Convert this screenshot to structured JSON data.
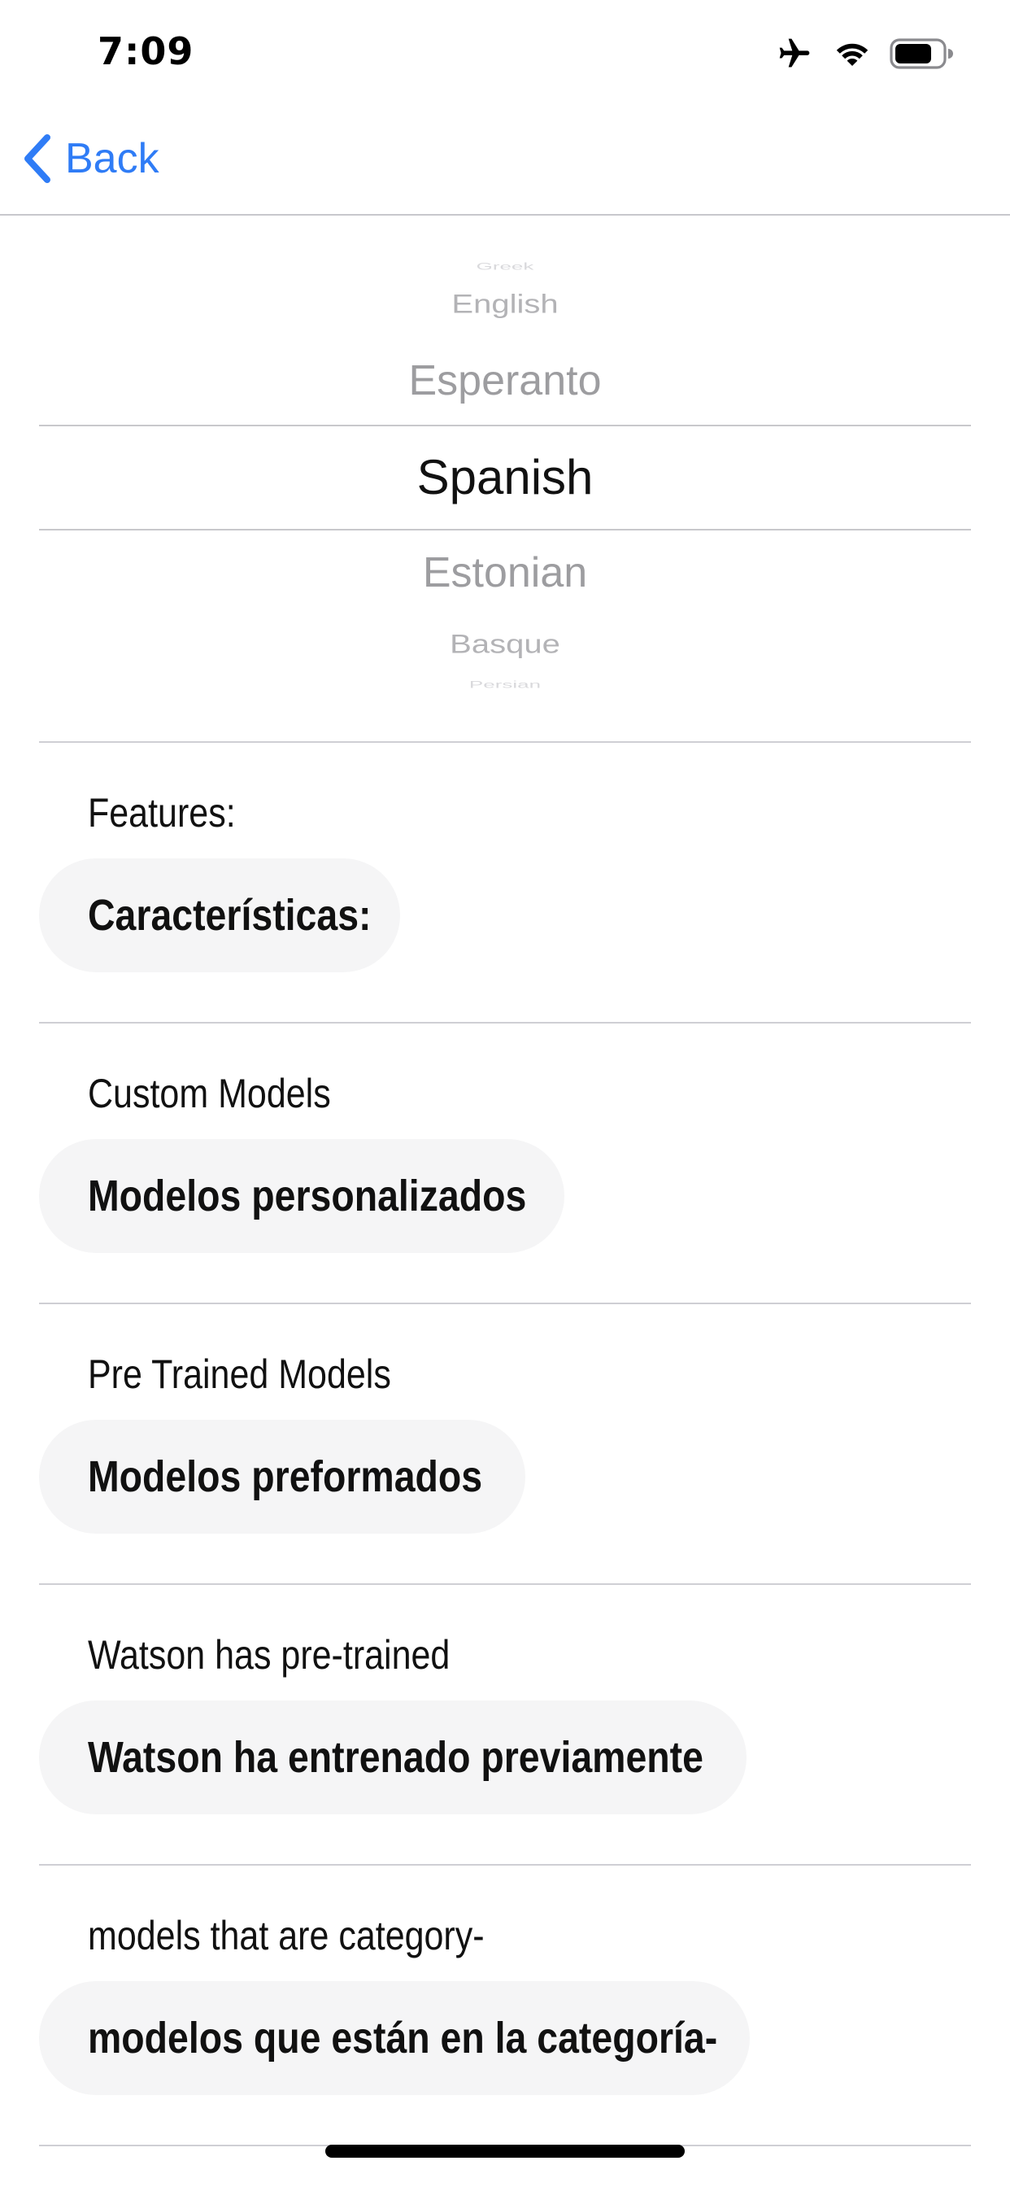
{
  "status_bar": {
    "time": "7:09"
  },
  "nav": {
    "back_label": "Back"
  },
  "picker": {
    "items": [
      "Greek",
      "English",
      "Esperanto",
      "Spanish",
      "Estonian",
      "Basque",
      "Persian"
    ],
    "selected": "Spanish"
  },
  "translations": [
    {
      "source": "Features:",
      "translated": "Características:"
    },
    {
      "source": "Custom Models",
      "translated": "Modelos personalizados"
    },
    {
      "source": "Pre Trained Models",
      "translated": "Modelos preformados"
    },
    {
      "source": "Watson has pre-trained",
      "translated": "Watson ha entrenado previamente"
    },
    {
      "source": "models that are category-",
      "translated": "modelos que están en la categoría-"
    }
  ],
  "colors": {
    "accent": "#2f7cf6",
    "pill_background": "#f5f5f6",
    "divider": "#cfcfd4"
  },
  "icons": [
    "airplane-icon",
    "wifi-icon",
    "battery-icon",
    "chevron-left-icon"
  ]
}
